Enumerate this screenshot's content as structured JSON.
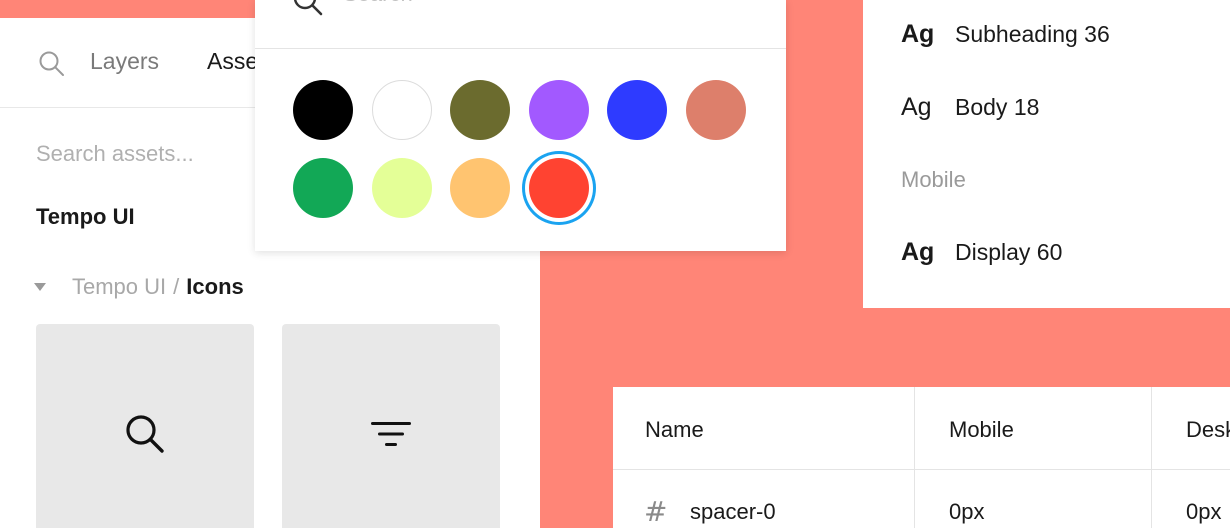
{
  "assets_panel": {
    "tabs": {
      "layers": "Layers",
      "assets": "Assets"
    },
    "search_placeholder": "Search assets...",
    "library_title": "Tempo UI",
    "group": {
      "parent": "Tempo UI",
      "separator": "/",
      "current": "Icons"
    },
    "icon_tiles": [
      {
        "icon": "search-icon"
      },
      {
        "icon": "filter-icon"
      }
    ]
  },
  "color_popover": {
    "search_placeholder": "Search",
    "swatches": [
      {
        "color": "#000000"
      },
      {
        "color": "#FFFFFF"
      },
      {
        "color": "#6B6B2E"
      },
      {
        "color": "#A259FF"
      },
      {
        "color": "#2E3BFF"
      },
      {
        "color": "#DD7F6B"
      },
      {
        "color": "#12A856"
      },
      {
        "color": "#E4FF97"
      },
      {
        "color": "#FFC470"
      },
      {
        "color": "#FF4331"
      }
    ],
    "selected_index": 9,
    "selection_ring_color": "#1AA3F0"
  },
  "text_styles": {
    "items": [
      {
        "sample": "Ag",
        "label": "Subheading 36",
        "bold": true
      },
      {
        "sample": "Ag",
        "label": "Body 18",
        "bold": false
      }
    ],
    "section_label": "Mobile",
    "section_items": [
      {
        "sample": "Ag",
        "label": "Display 60",
        "bold": true
      }
    ]
  },
  "spacing_table": {
    "headers": [
      "Name",
      "Mobile",
      "Desk"
    ],
    "rows": [
      {
        "name": "spacer-0",
        "mobile": "0px",
        "desktop": "0px"
      }
    ],
    "row_icon": "hash-icon"
  },
  "colors": {
    "background": "#FF8577",
    "panel": "#FFFFFF",
    "tile": "#E8E8E8"
  }
}
